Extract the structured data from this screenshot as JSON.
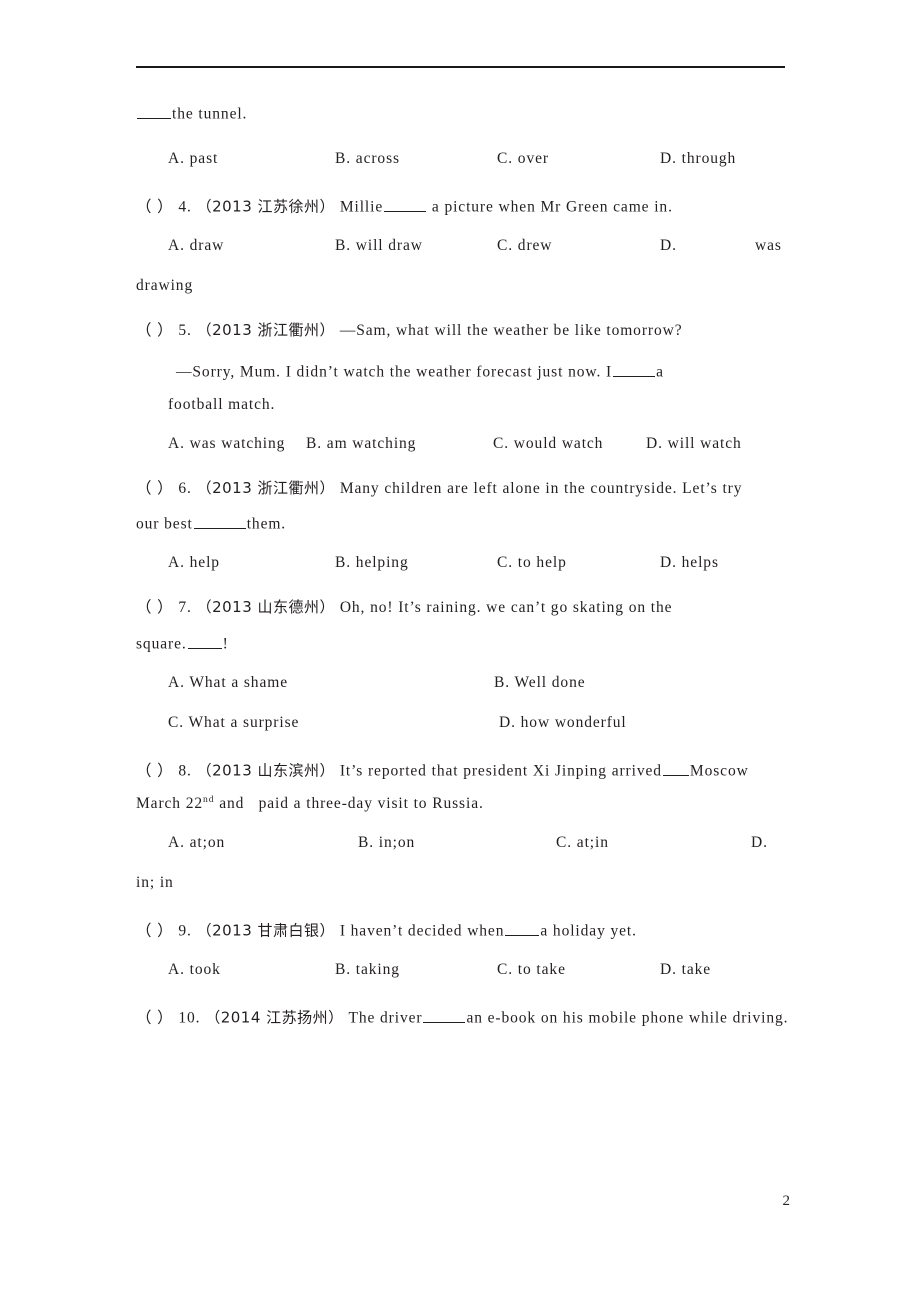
{
  "document": {
    "page_number": "2",
    "header_rule": true
  },
  "continued_stem": {
    "blank": "____",
    "text": "the tunnel."
  },
  "questions": [
    {
      "id": "q3-continued-options",
      "options": [
        {
          "label": "A.",
          "text": "past"
        },
        {
          "label": "B.",
          "text": "across"
        },
        {
          "label": "C.",
          "text": "over"
        },
        {
          "label": "D.",
          "text": "through"
        }
      ]
    },
    {
      "id": "q4",
      "checkbox": "（ ）",
      "number": "4.",
      "source": "（2013 江苏徐州）",
      "stem_before": "Millie",
      "blank": "_____",
      "stem_after": " a picture when Mr Green came in.",
      "options": [
        {
          "label": "A.",
          "text": "draw"
        },
        {
          "label": "B.",
          "text": "will draw"
        },
        {
          "label": "C.",
          "text": "drew"
        },
        {
          "label": "D.",
          "text": ""
        }
      ],
      "option_d_tail_inline": "was",
      "option_d_wrap": "drawing"
    },
    {
      "id": "q5",
      "checkbox": "（ ）",
      "number": "5.",
      "source": "（2013 浙江衢州）",
      "stem_line1": "—Sam, what will the weather be like tomorrow?",
      "stem_line2_before": "—Sorry, Mum. I didn’t watch the weather forecast just now. I",
      "stem_line2_blank": "_____",
      "stem_line2_after": "a",
      "stem_line3": "football match.",
      "options": [
        {
          "label": "A.",
          "text": "was watching"
        },
        {
          "label": "B.",
          "text": "am watching"
        },
        {
          "label": "C.",
          "text": "would watch"
        },
        {
          "label": "D.",
          "text": "will watch"
        }
      ]
    },
    {
      "id": "q6",
      "checkbox": "（ ）",
      "number": "6.",
      "source": "（2013 浙江衢州）",
      "stem_line1": "Many children are left alone in the countryside. Let’s try",
      "stem_line2_before": "our best",
      "stem_line2_blank": "_______",
      "stem_line2_after": "them.",
      "options": [
        {
          "label": "A.",
          "text": "help"
        },
        {
          "label": "B.",
          "text": "helping"
        },
        {
          "label": "C.",
          "text": "to help"
        },
        {
          "label": "D.",
          "text": "helps"
        }
      ]
    },
    {
      "id": "q7",
      "checkbox": "（ ）",
      "number": "7.",
      "source": "（2013 山东德州）",
      "stem_line1": "Oh, no! It’s raining. we can’t go skating on the",
      "stem_line2_before": "square.",
      "stem_line2_blank": "____",
      "stem_line2_after": "!",
      "options": [
        {
          "label": "A.",
          "text": "What a shame"
        },
        {
          "label": "B.",
          "text": "Well done"
        },
        {
          "label": "C.",
          "text": "What a surprise"
        },
        {
          "label": "D.",
          "text": "how wonderful"
        }
      ]
    },
    {
      "id": "q8",
      "checkbox": "（ ）",
      "number": "8.",
      "source": "（2013 山东滨州）",
      "stem_line1_before": "It’s reported that president Xi Jinping arrived",
      "stem_line1_blank": "___",
      "stem_line1_after": "Moscow",
      "stem_line2_a": "March 22",
      "stem_line2_sup": "nd",
      "stem_line2_b": " and   paid a three-day visit to Russia.",
      "options": [
        {
          "label": "A.",
          "text": "at;on"
        },
        {
          "label": "B.",
          "text": "in;on"
        },
        {
          "label": "C.",
          "text": "at;in"
        },
        {
          "label": "D.",
          "text": ""
        }
      ],
      "option_d_wrap": "in; in"
    },
    {
      "id": "q9",
      "checkbox": "（ ）",
      "number": "9.",
      "source": "（2013 甘肃白银）",
      "stem_before": "I haven’t decided when",
      "blank": "____",
      "stem_after": "a holiday yet.",
      "options": [
        {
          "label": "A.",
          "text": "took"
        },
        {
          "label": "B.",
          "text": "taking"
        },
        {
          "label": "C.",
          "text": "to take"
        },
        {
          "label": "D.",
          "text": "take"
        }
      ]
    },
    {
      "id": "q10",
      "checkbox": "（ ）",
      "number": "10.",
      "source": "（2014 江苏扬州）",
      "stem_before": "The driver",
      "blank": "_____",
      "stem_after": "an e-book on his mobile phone while driving."
    }
  ]
}
